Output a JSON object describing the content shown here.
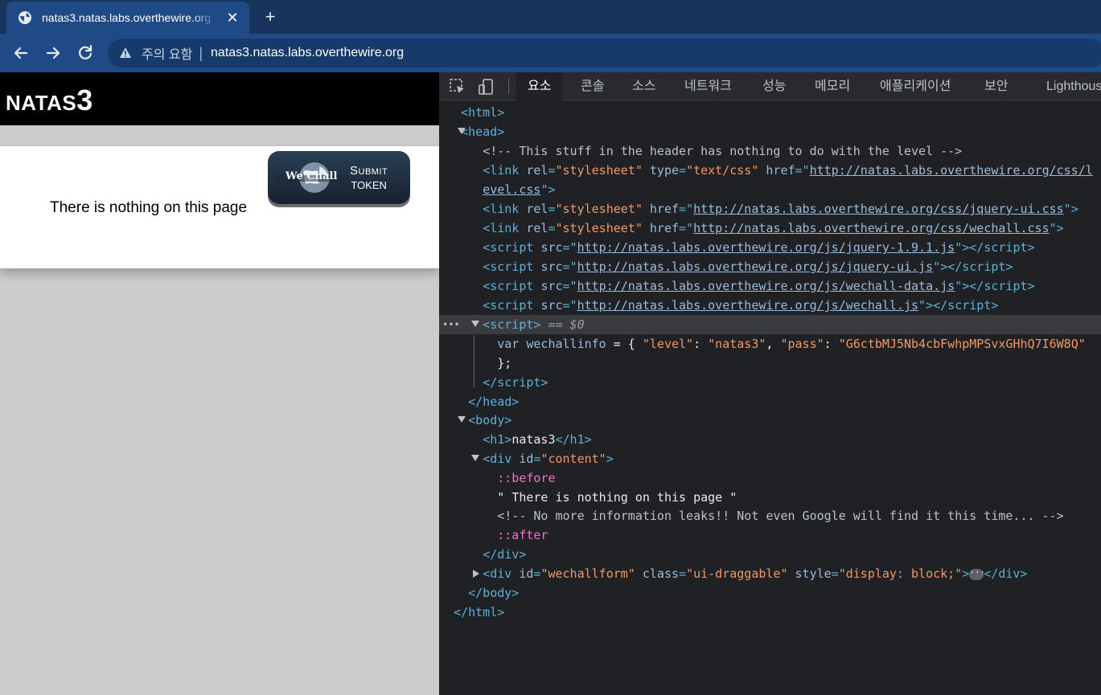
{
  "browser": {
    "tab_title": "natas3.natas.labs.overthewire.org",
    "omnibox_warning": "주의 요함",
    "omnibox_separator": "|",
    "url": "natas3.natas.labs.overthewire.org"
  },
  "page": {
    "heading_prefix": "NATAS",
    "heading_number": "3",
    "content_text": "There is nothing on this page",
    "wechall_logo_text": "We Chall",
    "submit_label": "Submit",
    "token_label": "TOKEN"
  },
  "devtools": {
    "tabs": [
      "요소",
      "콘솔",
      "소스",
      "네트워크",
      "성능",
      "메모리",
      "애플리케이션",
      "보안",
      "Lighthouse"
    ],
    "active_tab": "요소",
    "lines": {
      "html_open": "<html>",
      "head_open": "<head>",
      "comment1": "<!-- This stuff in the header has nothing to do with the level -->",
      "link1_href_a": "http://natas.labs.overthewire.org/css/l",
      "link1_href_b": "evel.css",
      "link2_href": "http://natas.labs.overthewire.org/css/jquery-ui.css",
      "link3_href": "http://natas.labs.overthewire.org/css/wechall.css",
      "script1_src": "http://natas.labs.overthewire.org/js/jquery-1.9.1.js",
      "script2_src": "http://natas.labs.overthewire.org/js/jquery-ui.js",
      "script3_src": "http://natas.labs.overthewire.org/js/wechall-data.js",
      "script4_src": "http://natas.labs.overthewire.org/js/wechall.js",
      "selected_marker": "== $0",
      "js_var": "wechallinfo",
      "js_level_key": "\"level\"",
      "js_level_val": "\"natas3\"",
      "js_pass_key": "\"pass\"",
      "js_pass_val": "\"G6ctbMJ5Nb4cbFwhpMPSvxGHhQ7I6W8Q\"",
      "h1_text": "natas3",
      "content_id": "\"content\"",
      "pseudo_before": "::before",
      "text_node": "\" There is nothing on this page \"",
      "comment2": "<!-- No more information leaks!! Not even Google will find it this time... -->",
      "pseudo_after": "::after",
      "wechallform_id": "\"wechallform\"",
      "wechallform_class": "\"ui-draggable\"",
      "wechallform_style": "\"display: block;\""
    }
  }
}
